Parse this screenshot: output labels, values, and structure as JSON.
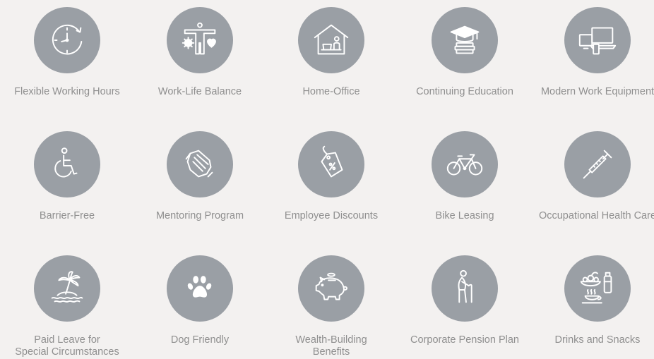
{
  "colors": {
    "background": "#f3f1f0",
    "circle": "#9a9fa5",
    "icon": "#ffffff",
    "label": "#8f8f8f"
  },
  "benefits": [
    {
      "label": "Flexible Working Hours",
      "icon": "clock-icon"
    },
    {
      "label": "Work-Life Balance",
      "icon": "balance-icon"
    },
    {
      "label": "Home-Office",
      "icon": "home-office-icon"
    },
    {
      "label": "Continuing Education",
      "icon": "graduation-cap-icon"
    },
    {
      "label": "Modern Work Equipment",
      "icon": "devices-icon"
    },
    {
      "label": "Barrier-Free",
      "icon": "wheelchair-icon"
    },
    {
      "label": "Mentoring Program",
      "icon": "handshake-icon"
    },
    {
      "label": "Employee Discounts",
      "icon": "discount-tag-icon"
    },
    {
      "label": "Bike Leasing",
      "icon": "bicycle-icon"
    },
    {
      "label": "Occupational Health Care",
      "icon": "syringe-icon"
    },
    {
      "label": "Paid Leave for",
      "label2": "Special Circumstances",
      "icon": "island-icon"
    },
    {
      "label": "Dog Friendly",
      "icon": "paw-icon"
    },
    {
      "label": "Wealth-Building",
      "label2": "Benefits",
      "icon": "piggy-bank-icon"
    },
    {
      "label": "Corporate Pension Plan",
      "icon": "elderly-person-icon"
    },
    {
      "label": "Drinks and Snacks",
      "icon": "drinks-snacks-icon"
    }
  ]
}
